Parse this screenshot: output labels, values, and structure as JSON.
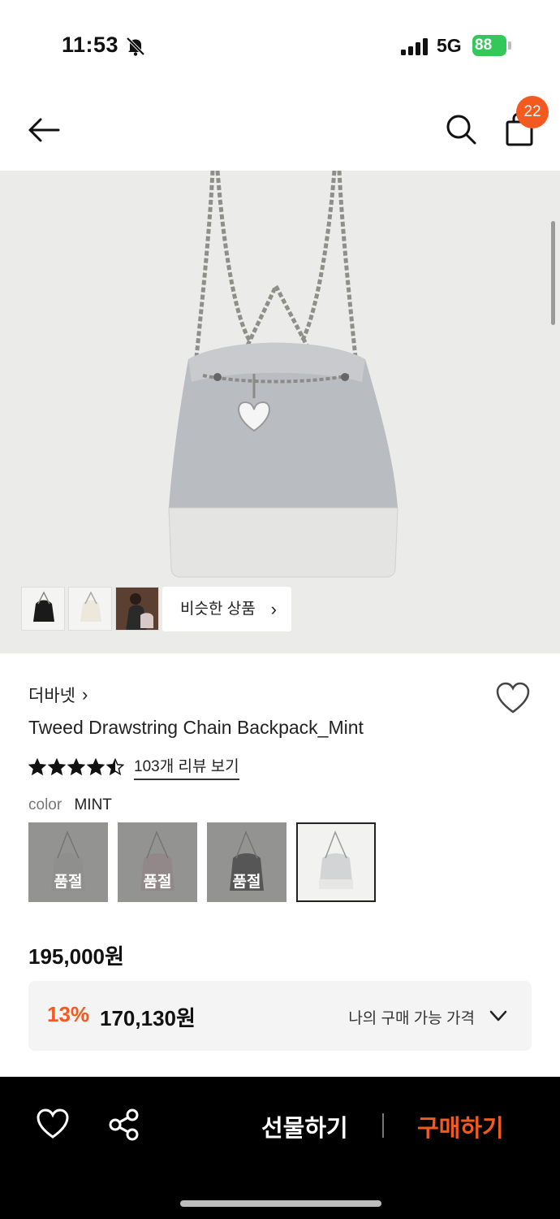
{
  "status_bar": {
    "time": "11:53",
    "network": "5G",
    "battery": "88"
  },
  "header": {
    "cart_count": "22"
  },
  "hero": {
    "similar_label": "비슷한 상품",
    "similar_chevron": "›"
  },
  "product": {
    "brand": "더바넷",
    "brand_chevron": "›",
    "title": "Tweed Drawstring Chain Backpack_Mint",
    "rating": 4.5,
    "review_link": "103개 리뷰 보기",
    "color_label": "color",
    "color_value": "MINT",
    "swatches": [
      {
        "status": "품절"
      },
      {
        "status": "품절"
      },
      {
        "status": "품절"
      },
      {
        "status": ""
      }
    ],
    "price": "195,000원",
    "discount": "13%",
    "sale_price": "170,130원",
    "my_price_label": "나의 구매 가능 가격"
  },
  "bottom_bar": {
    "gift_label": "선물하기",
    "buy_label": "구매하기"
  },
  "colors": {
    "accent": "#f25a1f",
    "battery": "#34c759"
  }
}
